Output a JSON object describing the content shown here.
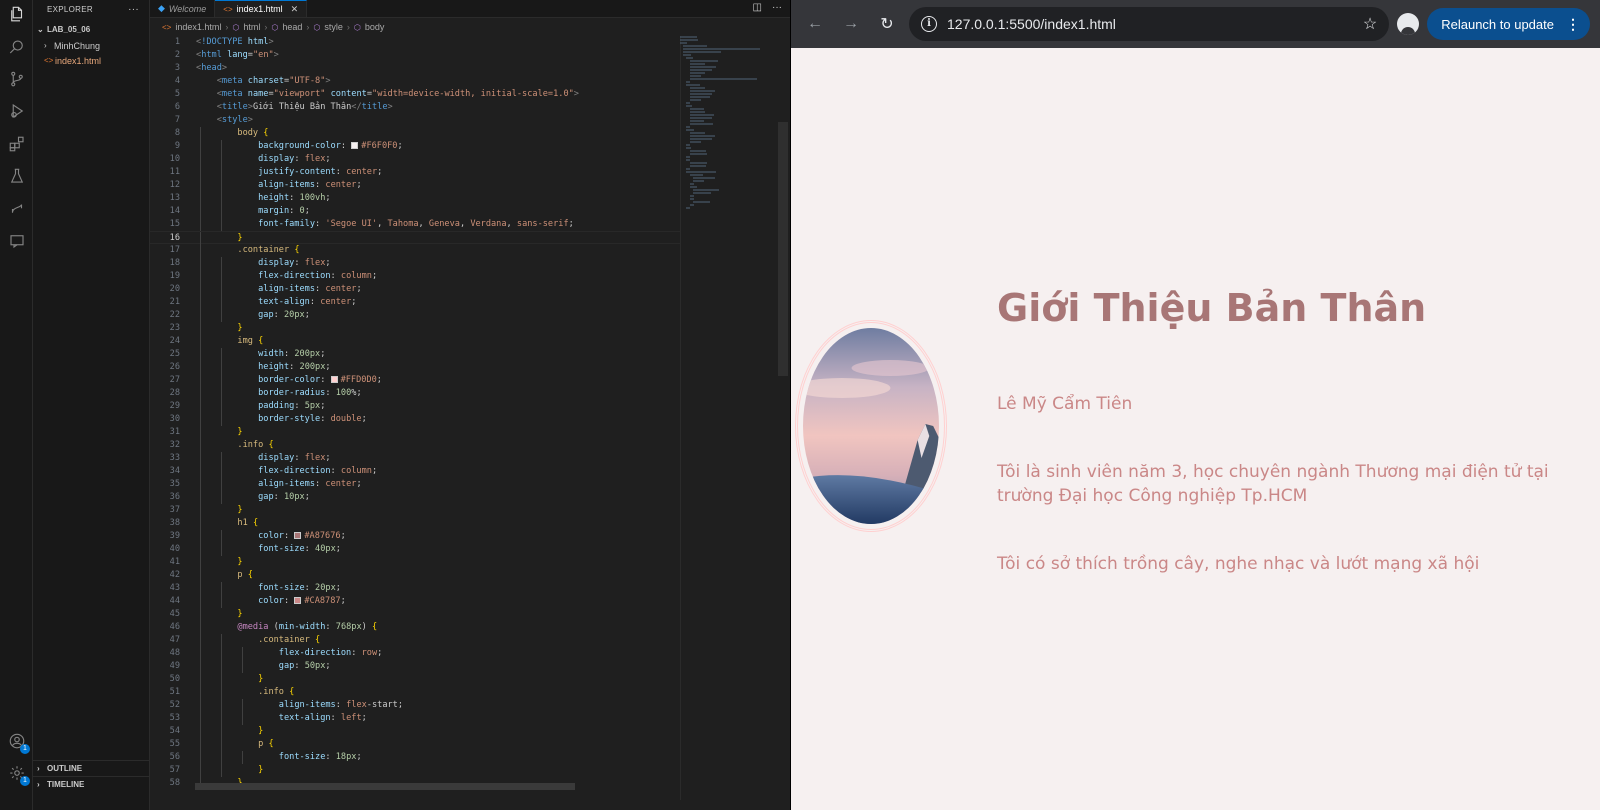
{
  "vscode": {
    "explorer": {
      "title": "EXPLORER",
      "more": "···",
      "folder": "LAB_05_06",
      "items": [
        {
          "label": "MinhChung",
          "type": "folder"
        },
        {
          "label": "index1.html",
          "type": "file"
        }
      ],
      "outline": "OUTLINE",
      "timeline": "TIMELINE"
    },
    "tabs": [
      {
        "label": "Welcome",
        "icon": "vscode-icon"
      },
      {
        "label": "index1.html",
        "icon": "html-icon",
        "active": true,
        "close": "✕"
      }
    ],
    "breadcrumbs": [
      "index1.html",
      "html",
      "head",
      "style",
      "body"
    ],
    "badges": {
      "accounts": "1",
      "manage": "1"
    },
    "code_lines": [
      "<!DOCTYPE html>",
      "<html lang=\"en\">",
      "<head>",
      "    <meta charset=\"UTF-8\">",
      "    <meta name=\"viewport\" content=\"width=device-width, initial-scale=1.0\">",
      "    <title>Giới Thiệu Bản Thân</title>",
      "    <style>",
      "        body {",
      "            background-color: #F6F0F0;",
      "            display: flex;",
      "            justify-content: center;",
      "            align-items: center;",
      "            height: 100vh;",
      "            margin: 0;",
      "            font-family: 'Segoe UI', Tahoma, Geneva, Verdana, sans-serif;",
      "        }",
      "        .container {",
      "            display: flex;",
      "            flex-direction: column;",
      "            align-items: center;",
      "            text-align: center;",
      "            gap: 20px;",
      "        }",
      "        img {",
      "            width: 200px;",
      "            height: 200px;",
      "            border-color: #FFD0D0;",
      "            border-radius: 100%;",
      "            padding: 5px;",
      "            border-style: double;",
      "        }",
      "        .info {",
      "            display: flex;",
      "            flex-direction: column;",
      "            align-items: center;",
      "            gap: 10px;",
      "        }",
      "        h1 {",
      "            color: #A87676;",
      "            font-size: 40px;",
      "        }",
      "        p {",
      "            font-size: 20px;",
      "            color: #CA8787;",
      "        }",
      "        @media (min-width: 768px) {",
      "            .container {",
      "                flex-direction: row;",
      "                gap: 50px;",
      "            }",
      "            .info {",
      "                align-items: flex-start;",
      "                text-align: left;",
      "            }",
      "            p {",
      "                font-size: 18px;",
      "            }",
      "        }"
    ],
    "current_line": 16
  },
  "browser": {
    "url": "127.0.0.1:5500/index1.html",
    "relaunch_label": "Relaunch to update",
    "page": {
      "title": "Giới Thiệu Bản Thân",
      "name": "Lê Mỹ Cẩm Tiên",
      "intro": "Tôi là sinh viên năm 3, học chuyên ngành Thương mại điện tử tại trường Đại học Công nghiệp Tp.HCM",
      "hobbies": "Tôi có sở thích trồng cây, nghe nhạc và lướt mạng xã hội"
    }
  },
  "colors": {
    "page_bg": "#F6F0F0",
    "heading": "#A87676",
    "text": "#CA8787",
    "img_border": "#FFD0D0",
    "accent": "#0078D4"
  }
}
